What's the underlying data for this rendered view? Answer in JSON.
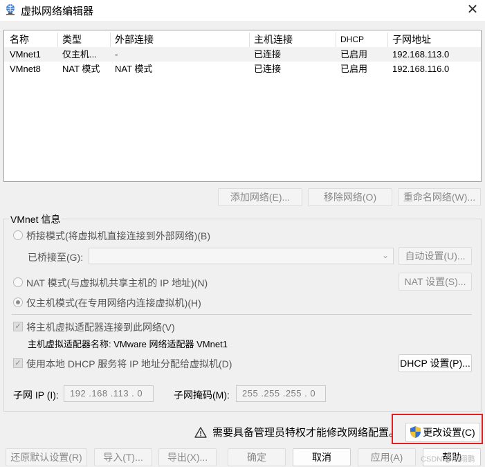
{
  "window": {
    "title": "虚拟网络编辑器",
    "close_label": "✕"
  },
  "network_table": {
    "columns": [
      "名称",
      "类型",
      "外部连接",
      "主机连接",
      "DHCP",
      "子网地址"
    ],
    "rows": [
      [
        "VMnet1",
        "仅主机...",
        "-",
        "已连接",
        "已启用",
        "192.168.113.0"
      ],
      [
        "VMnet8",
        "NAT 模式",
        "NAT 模式",
        "已连接",
        "已启用",
        "192.168.116.0"
      ]
    ]
  },
  "table_buttons": {
    "add": "添加网络(E)...",
    "remove": "移除网络(O)",
    "rename": "重命名网络(W)..."
  },
  "vmnet_info": {
    "group_label": "VMnet 信息",
    "bridge_option": "桥接模式(将虚拟机直接连接到外部网络)(B)",
    "bridged_to_label": "已桥接至(G):",
    "bridged_to_value": "",
    "auto_settings": "自动设置(U)...",
    "nat_option": "NAT 模式(与虚拟机共享主机的 IP 地址)(N)",
    "nat_settings": "NAT 设置(S)...",
    "host_only_option": "仅主机模式(在专用网络内连接虚拟机)(H)",
    "selected_mode": "host_only",
    "connect_adapter": "将主机虚拟适配器连接到此网络(V)",
    "connect_adapter_checked": true,
    "adapter_name": "主机虚拟适配器名称: VMware 网络适配器 VMnet1",
    "use_dhcp": "使用本地 DHCP 服务将 IP 地址分配给虚拟机(D)",
    "use_dhcp_checked": true,
    "dhcp_settings": "DHCP 设置(P)...",
    "subnet_ip_label": "子网 IP (I):",
    "subnet_ip_value": "192 .168 .113 .  0",
    "subnet_mask_label": "子网掩码(M):",
    "subnet_mask_value": "255 .255 .255 .  0"
  },
  "admin_notice": {
    "text": "需要具备管理员特权才能修改网络配置。",
    "change_settings": "更改设置(C)"
  },
  "footer_buttons": {
    "restore_defaults": "还原默认设置(R)",
    "import": "导入(T)...",
    "export": "导出(X)...",
    "ok": "确定",
    "cancel": "取消",
    "apply": "应用(A)",
    "help": "帮助"
  },
  "watermark": "CSDN @陈翔鹏",
  "colors": {
    "highlight": "#e02020",
    "shield_blue": "#2f6fd6",
    "shield_yellow": "#f2c230"
  }
}
